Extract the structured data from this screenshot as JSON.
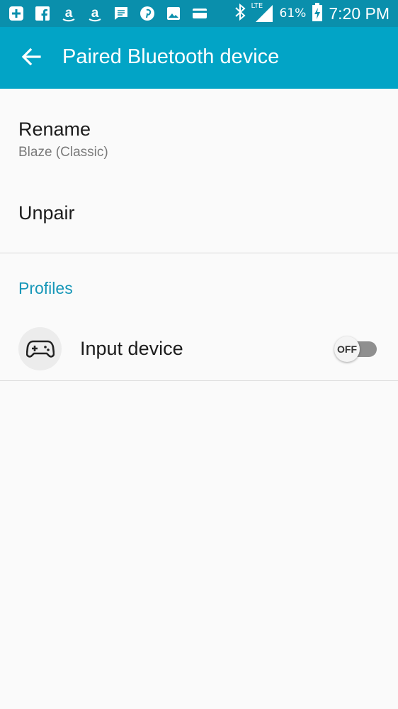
{
  "status_bar": {
    "notification_icons": [
      "add-icon",
      "facebook-icon",
      "amazon-icon",
      "amazon-icon",
      "message-icon",
      "pinterest-icon",
      "gallery-icon",
      "card-icon"
    ],
    "network": "LTE",
    "battery": "61%",
    "time": "7:20 PM"
  },
  "app_bar": {
    "title": "Paired Bluetooth device"
  },
  "rename": {
    "title": "Rename",
    "value": "Blaze (Classic)"
  },
  "unpair": {
    "title": "Unpair"
  },
  "profiles": {
    "header": "Profiles",
    "items": [
      {
        "label": "Input device",
        "icon": "gamepad-icon",
        "toggle": "OFF",
        "enabled": false
      }
    ]
  },
  "colors": {
    "status_bar": "#0a8fac",
    "app_bar": "#02a4c6",
    "accent": "#1797b8",
    "background": "#fafafa"
  }
}
